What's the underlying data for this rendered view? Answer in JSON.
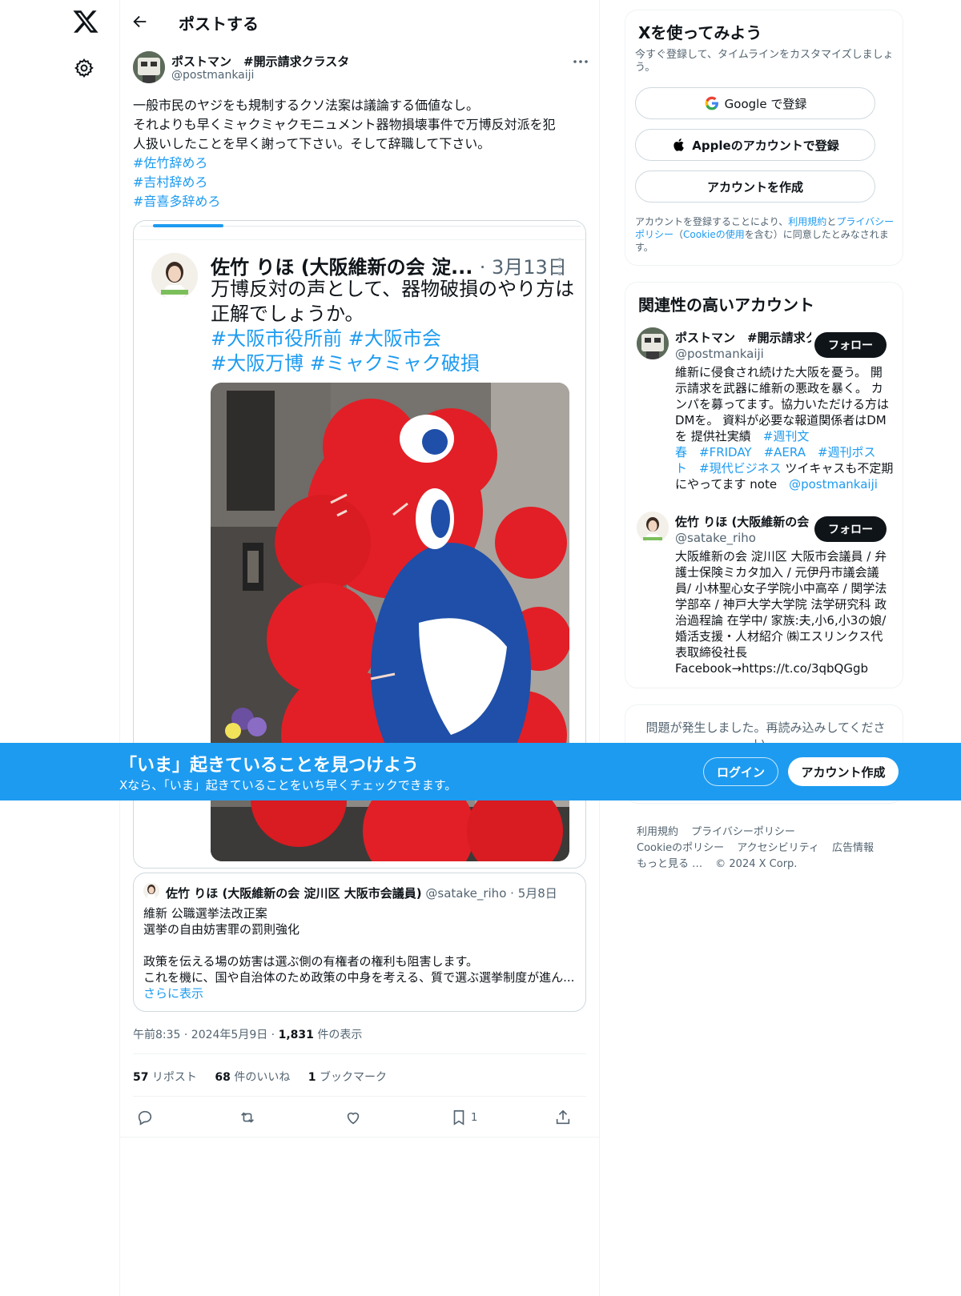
{
  "header": {
    "title": "ポストする"
  },
  "post": {
    "author_name": "ポストマン　#開示請求クラスタ",
    "author_handle": "@postmankaiji",
    "text_lines": [
      "一般市民のヤジをも規制するクソ法案は議論する価値なし。",
      "それよりも早くミャクミャクモニュメント器物損壊事件で万博反対派を犯",
      "人扱いしたことを早く謝って下さい。そして辞職して下さい。"
    ],
    "hashtags": [
      "#佐竹辞めろ",
      "#吉村辞めろ",
      "#音喜多辞めろ"
    ],
    "embedded": {
      "header_name": "佐竹 りほ (大阪維新の会 淀...",
      "header_date": "· 3月13日",
      "text_lines": [
        "万博反対の声として、器物破損のやり方は",
        "正解でしょうか。"
      ],
      "tag_lines": [
        "#大阪市役所前 #大阪市会",
        "#大阪万博 #ミャクミャク破損"
      ]
    },
    "quote": {
      "name": "佐竹 りほ (大阪維新の会 淀川区 大阪市会議員)",
      "handle": "@satake_riho",
      "date": "· 5月8日",
      "lines": [
        "維新 公職選挙法改正案",
        "選挙の自由妨害罪の罰則強化",
        "",
        "政策を伝える場の妨害は選ぶ側の有権者の権利も阻害します。",
        "これを機に、国や自治体のため政策の中身を考える、質で選ぶ選挙制度が進ん..."
      ],
      "show_more": "さらに表示"
    },
    "meta_time": "午前8:35 · 2024年5月9日 · ",
    "meta_views": "1,831",
    "meta_views_label": " 件の表示",
    "stats": {
      "reposts": "57",
      "reposts_label": " リポスト",
      "likes": "68",
      "likes_label": " 件のいいね",
      "bookmarks": "1",
      "bookmarks_label": " ブックマーク"
    },
    "bookmark_count": "1"
  },
  "sidebar": {
    "signup": {
      "title": "Xを使ってみよう",
      "subtitle": "今すぐ登録して、タイムラインをカスタマイズしましょう。",
      "google": "Google で登録",
      "apple": "Appleのアカウントで登録",
      "create": "アカウントを作成",
      "terms_1": "アカウントを登録することにより、",
      "terms_link1": "利用規約",
      "terms_2": "と",
      "terms_link2": "プライバシーポリシー",
      "terms_3": "（",
      "terms_link3": "Cookieの使用",
      "terms_4": "を含む）に同意したとみなされます。"
    },
    "related": {
      "title": "関連性の高いアカウント",
      "follow_label": "フォロー",
      "accounts": [
        {
          "name": "ポストマン　#開示請求クラスタ",
          "handle": "@postmankaiji",
          "bio_lines": [
            "維新に侵食され続けた大阪を憂う。 開",
            "示請求を武器に維新の悪政を暴く。 カ",
            "ンパを募ってます。協力いただける方は",
            "DMを。 資料が必要な報道関係者はDM"
          ],
          "bio_mixed": [
            {
              "text": "を 提供社実績　",
              "tag": "#週刊文"
            },
            {
              "tag": "春　#FRIDAY　#AERA　#週刊ポス"
            },
            {
              "tag": "ト　#現代ビジネス",
              "text": " ツイキャスも不定期"
            },
            {
              "text": "にやってます note　",
              "tag": "@postmankaiji"
            }
          ]
        },
        {
          "name": "佐竹 りほ (大阪維新の会",
          "handle": "@satake_riho",
          "bio_lines": [
            "大阪維新の会 淀川区 大阪市会議員 / 弁",
            "護士保険ミカタ加入 / 元伊丹市議会議",
            "員/ 小林聖心女子学院小中高卒 / 関学法",
            "学部卒 / 神戸大学大学院 法学研究科 政",
            "治過程論 在学中/ 家族:夫,小6,小3の娘/",
            "婚活支援・人材紹介 ㈱エスリンクス代",
            "表取締役社長",
            "Facebook→https://t.co/3qbQGgb"
          ]
        }
      ]
    },
    "error_text": "問題が発生しました。再読み込みしてください。",
    "footer": {
      "row1": [
        "利用規約",
        "プライバシーポリシー"
      ],
      "row2": [
        "Cookieのポリシー",
        "アクセシビリティ",
        "広告情報"
      ],
      "row3": [
        "もっと見る …",
        "© 2024 X Corp."
      ]
    }
  },
  "banner": {
    "title": "「いま」起きていることを見つけよう",
    "subtitle": "Xなら、「いま」起きていることをいち早くチェックできます。",
    "login": "ログイン",
    "create": "アカウント作成"
  },
  "colors": {
    "accent": "#1d9bf0",
    "text": "#0f1419",
    "muted": "#536471",
    "mascot_red": "#e8202a",
    "mascot_blue": "#1f4fa8"
  }
}
